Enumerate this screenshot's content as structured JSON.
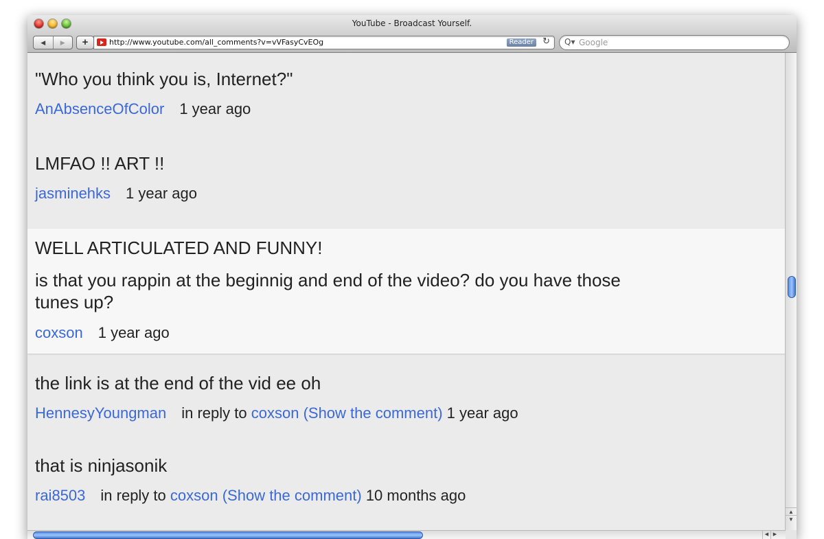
{
  "window": {
    "title": "YouTube - Broadcast Yourself."
  },
  "toolbar": {
    "back_glyph": "◀",
    "forward_glyph": "▶",
    "add_glyph": "+",
    "url": "http://www.youtube.com/all_comments?v=vVFasyCvEOg",
    "reader_label": "Reader",
    "reload_glyph": "↻",
    "search_glyph": "Q▾",
    "search_placeholder": "Google"
  },
  "comments": [
    {
      "text": "\"Who you think you is, Internet?\"",
      "author": "AnAbsenceOfColor",
      "time": "1 year ago"
    },
    {
      "text": "LMFAO !! ART !!",
      "author": "jasminehks",
      "time": "1 year ago"
    },
    {
      "title": "WELL ARTICULATED AND FUNNY!",
      "text_line1": "is that you rappin at the beginnig and end of the video? do you have those",
      "text_line2": "tunes up?",
      "author": "coxson",
      "time": "1 year ago",
      "highlighted": true
    },
    {
      "text": "the link is at the end of the vid ee oh",
      "author": "HennesyYoungman",
      "reply_prefix": "in reply to",
      "reply_link": "coxson (Show the comment)",
      "time": "1 year ago"
    },
    {
      "text": "that is ninjasonik",
      "author": "rai8503",
      "reply_prefix": "in reply to",
      "reply_link": "coxson (Show the comment)",
      "time": "10 months ago"
    }
  ],
  "scrollbar": {
    "up_glyph": "▲",
    "down_glyph": "▼",
    "left_glyph": "◀",
    "right_glyph": "▶"
  },
  "colors": {
    "link": "#3b68d8",
    "text": "#222222",
    "background": "#ebebeb",
    "highlight_row": "#f7f7f7"
  }
}
